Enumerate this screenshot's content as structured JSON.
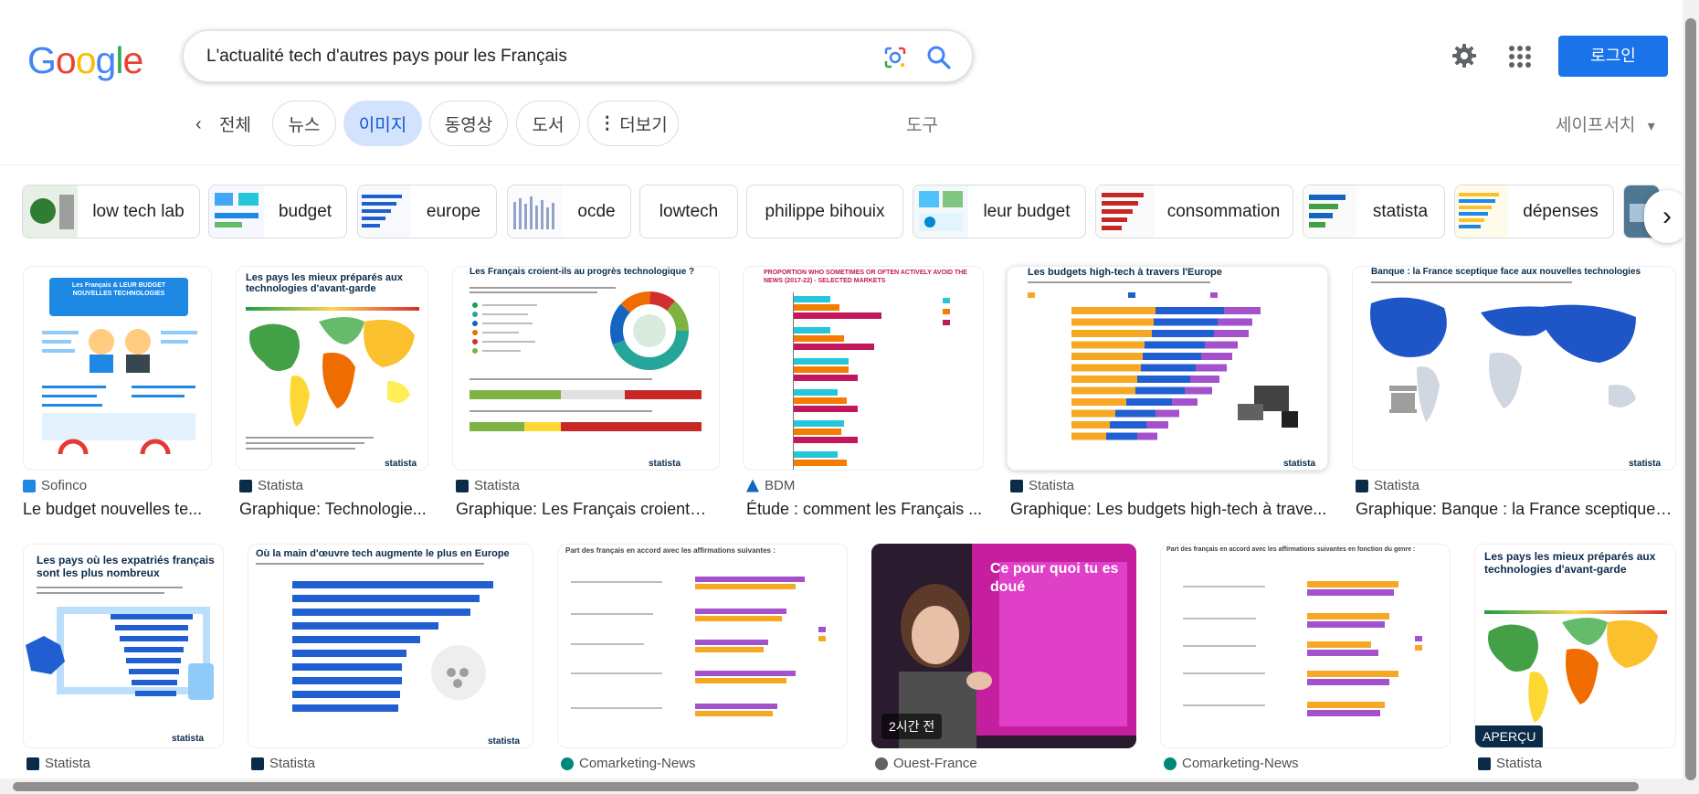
{
  "header": {
    "logo_letters": [
      "G",
      "o",
      "o",
      "g",
      "l",
      "e"
    ],
    "logo_colors": [
      "#4285F4",
      "#EA4335",
      "#FBBC05",
      "#4285F4",
      "#34A853",
      "#EA4335"
    ],
    "query": "L'actualité tech d'autres pays pour les Français",
    "login_label": "로그인",
    "icons": {
      "lens": "google-lens-icon",
      "search": "search-icon",
      "settings": "gear-icon",
      "apps": "apps-grid-icon"
    }
  },
  "tabs": {
    "back_glyph": "‹",
    "all_label": "전체",
    "chips": [
      "뉴스",
      "이미지",
      "동영상",
      "도서",
      "더보기"
    ],
    "more_glyph": "⋮",
    "active": "이미지",
    "tools_label": "도구",
    "safesearch_label": "세이프서치",
    "safesearch_caret": "▾"
  },
  "related": [
    {
      "label": "low tech lab"
    },
    {
      "label": "budget"
    },
    {
      "label": "europe"
    },
    {
      "label": "ocde"
    },
    {
      "label": "lowtech"
    },
    {
      "label": "philippe bihouix"
    },
    {
      "label": "leur budget"
    },
    {
      "label": "consommation"
    },
    {
      "label": "statista"
    },
    {
      "label": "dépenses"
    }
  ],
  "next_glyph": "›",
  "results_row1": [
    {
      "source": "Sofinco",
      "title": "Le budget nouvelles te...",
      "img_heading": "Les Français & LEUR BUDGET NOUVELLES TECHNOLOGIES",
      "fav": "#1e88e5"
    },
    {
      "source": "Statista",
      "title": "Graphique: Technologie...",
      "img_heading": "Les pays les mieux préparés aux technologies d'avant-garde",
      "fav": "#0b2b4a"
    },
    {
      "source": "Statista",
      "title": "Graphique: Les Français croient-il...",
      "img_heading": "Les Français croient-ils au progrès technologique ?",
      "fav": "#0b2b4a"
    },
    {
      "source": "BDM",
      "title": "Étude : comment les Français ...",
      "img_heading": "PROPORTION WHO SOMETIMES OR OFTEN ACTIVELY AVOID THE NEWS (2017-22) - SELECTED MARKETS",
      "fav": "#1565c0"
    },
    {
      "source": "Statista",
      "title": "Graphique: Les budgets high-tech à trave...",
      "img_heading": "Les budgets high-tech à travers l'Europe",
      "fav": "#0b2b4a"
    },
    {
      "source": "Statista",
      "title": "Graphique: Banque : la France sceptique f...",
      "img_heading": "Banque : la France sceptique face aux nouvelles technologies",
      "fav": "#0b2b4a"
    }
  ],
  "results_row2": [
    {
      "source": "Statista",
      "img_heading": "Les pays où les expatriés français sont les plus nombreux",
      "fav": "#0b2b4a"
    },
    {
      "source": "Statista",
      "img_heading": "Où la main d'œuvre tech augmente le plus en Europe",
      "fav": "#0b2b4a"
    },
    {
      "source": "Comarketing-News",
      "img_heading": "Part des français en accord avec les affirmations suivantes :",
      "fav": "#00897b"
    },
    {
      "source": "Ouest-France",
      "img_heading": "Ce pour quoi tu es doué",
      "badge": "2시간 전",
      "fav": "#5f6368"
    },
    {
      "source": "Comarketing-News",
      "img_heading": "Part des français en accord avec les affirmations suivantes en fonction du genre :",
      "fav": "#00897b"
    },
    {
      "source": "Statista",
      "img_heading": "Les pays les mieux préparés aux technologies d'avant-garde",
      "badge": "APERÇU",
      "fav": "#0b2b4a"
    }
  ],
  "colors": {
    "accent": "#1a73e8",
    "chip_active_bg": "#d3e3fd",
    "chart_orange": "#f7a823",
    "chart_blue": "#1f5fd1",
    "chart_purple": "#a352cc"
  }
}
